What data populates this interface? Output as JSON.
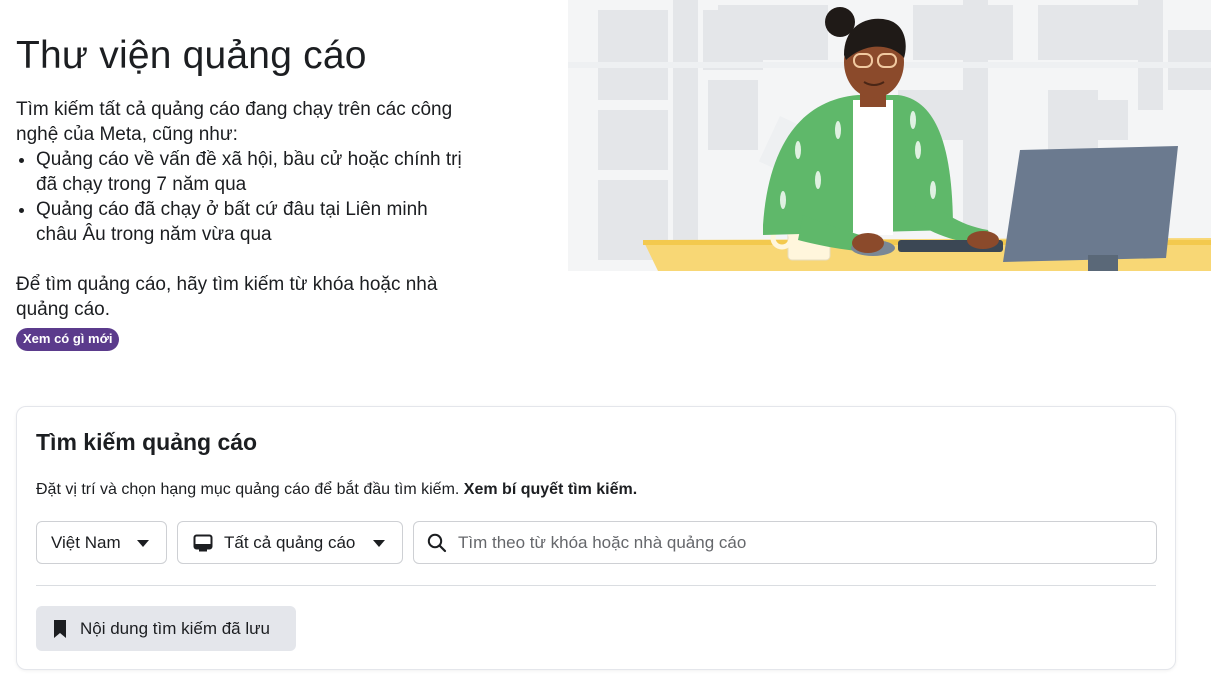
{
  "hero": {
    "title": "Thư viện quảng cáo",
    "intro": "Tìm kiếm tất cả quảng cáo đang chạy trên các công nghệ của Meta, cũng như:",
    "bullets": [
      "Quảng cáo về vấn đề xã hội, bầu cử hoặc chính trị đã chạy trong 7 năm qua",
      "Quảng cáo đã chạy ở bất cứ đâu tại Liên minh châu Âu trong năm vừa qua"
    ],
    "instruction": "Để tìm quảng cáo, hãy tìm kiếm từ khóa hoặc nhà quảng cáo.",
    "badge": "Xem có gì mới"
  },
  "search_card": {
    "title": "Tìm kiếm quảng cáo",
    "description": "Đặt vị trí và chọn hạng mục quảng cáo để bắt đầu tìm kiếm.",
    "tips_link": "Xem bí quyết tìm kiếm.",
    "country_select": {
      "value": "Việt Nam",
      "icon": "caret-down-icon"
    },
    "category_select": {
      "value": "Tất cả quảng cáo",
      "icon": "ad-category-icon"
    },
    "search": {
      "placeholder": "Tìm theo từ khóa hoặc nhà quảng cáo",
      "value": "",
      "icon": "search-icon"
    },
    "saved_searches_button": {
      "label": "Nội dung tìm kiếm đã lưu",
      "icon": "bookmark-icon"
    }
  },
  "colors": {
    "badge_bg": "#5b3b8c",
    "text_primary": "#1c1e21",
    "placeholder": "#65676b",
    "button_bg": "#e4e6eb",
    "desk": "#f8d775",
    "monitor": "#6b7a8f",
    "jacket": "#5fb86a"
  }
}
